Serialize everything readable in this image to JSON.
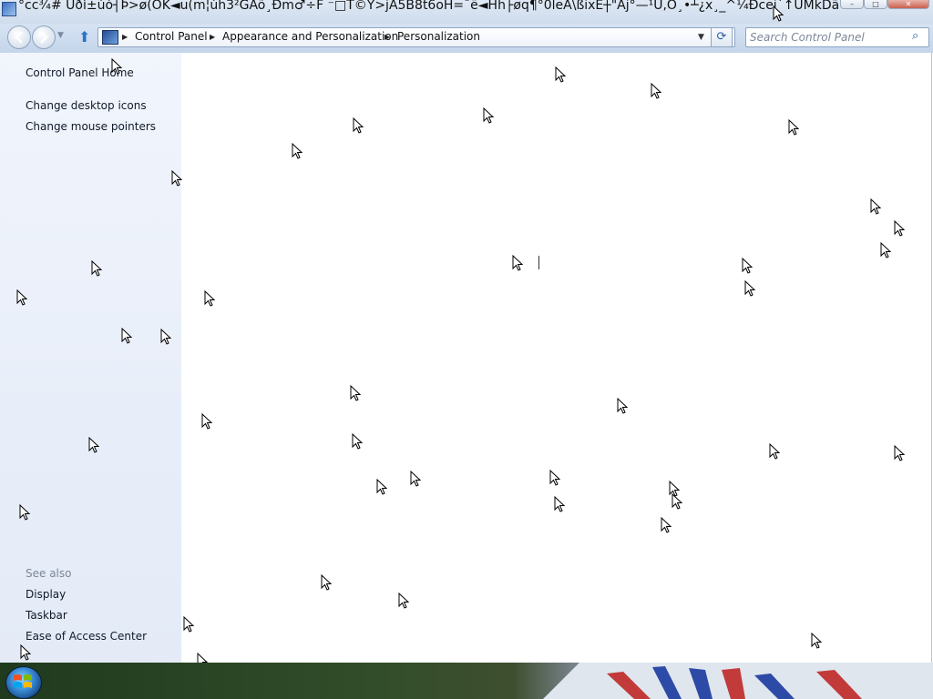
{
  "window": {
    "title": "°ϲc¾# Uðì±ùò┤Þ>ø(OK◄u(m¦ùh3²GAõ¸Ðm♂÷F ⁻□T©Y>jA5B8t6oH=¯ë◄Hh├øq¶°0leA\\ßixE┼\"Aj°—¹U,O¸•┴¿x¸_^¼Ðcei`↑UMkDãõO(¦Ss`Y!!..."
  },
  "nav": {
    "breadcrumb": [
      "Control Panel",
      "Appearance and Personalization",
      "Personalization"
    ],
    "search_placeholder": "Search Control Panel"
  },
  "sidebar": {
    "home_link": "Control Panel Home",
    "tasks": [
      "Change desktop icons",
      "Change mouse pointers"
    ],
    "see_also_heading": "See also",
    "see_also": [
      "Display",
      "Taskbar",
      "Ease of Access Center"
    ]
  },
  "icons": {
    "back": "back-arrow-icon",
    "forward": "forward-arrow-icon",
    "up": "up-arrow-icon",
    "refresh": "refresh-icon",
    "search": "search-icon",
    "cursor": "mouse-pointer-icon",
    "start": "windows-logo-icon"
  },
  "colors": {
    "sidebar_bg": "#e8eef9",
    "link_text": "#101a2a",
    "see_also_text": "#7d8797",
    "chrome": "#cfdcec"
  }
}
